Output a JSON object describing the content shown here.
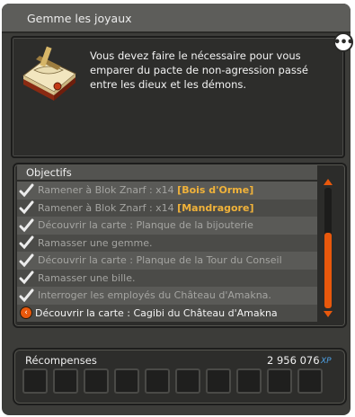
{
  "window": {
    "title": "Gemme les joyaux"
  },
  "description": {
    "text": "Vous devez faire le nécessaire pour vous emparer du pacte de non-agression passé entre les dieux et les démons.",
    "icon": "book-scroll-icon",
    "bubble_icon": "speech-bubble-icon",
    "bubble_text": "•••"
  },
  "objectives": {
    "header": "Objectifs",
    "items": [
      {
        "done": true,
        "text": "Ramener à Blok Znarf : x14 ",
        "highlight": "[Bois d'Orme]"
      },
      {
        "done": true,
        "text": "Ramener à Blok Znarf : x14 ",
        "highlight": "[Mandragore]"
      },
      {
        "done": true,
        "text": "Découvrir la carte : Planque de la bijouterie",
        "highlight": ""
      },
      {
        "done": true,
        "text": "Ramasser une gemme.",
        "highlight": ""
      },
      {
        "done": true,
        "text": "Découvrir la carte : Planque de la Tour du Conseil",
        "highlight": ""
      },
      {
        "done": true,
        "text": "Ramasser une bille.",
        "highlight": ""
      },
      {
        "done": true,
        "text": "Interroger les employés du Château d'Amakna.",
        "highlight": ""
      },
      {
        "done": false,
        "text": "Découvrir la carte : Cagibi du Château d'Amakna",
        "highlight": ""
      }
    ],
    "scroll_fraction": 0.6
  },
  "rewards": {
    "label": "Récompenses",
    "xp_value": "2 956 076",
    "xp_unit": "XP",
    "slot_count": 10
  },
  "colors": {
    "accent": "#e8580c",
    "highlight_text": "#f0b23a",
    "xp_unit": "#4fa3e8",
    "check": "#ececec"
  }
}
